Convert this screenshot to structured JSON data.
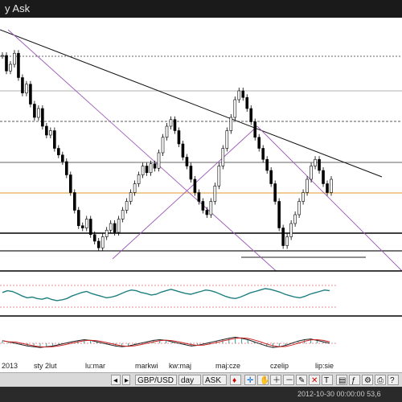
{
  "window": {
    "title_fragment": "y Ask"
  },
  "axis": {
    "date_labels": [
      "2013",
      "sty 2lut",
      "lu:mar",
      "markwi",
      "kw:maj",
      "maj:cze",
      "czelip",
      "lip:sie"
    ]
  },
  "toolbar": {
    "pair": "GBP/USD",
    "period": "day",
    "price_type": "ASK"
  },
  "status": {
    "datetime": "2012-10-30 00:00:00",
    "value": "53,6"
  },
  "colors": {
    "background": "#ffffff",
    "candle": "#000000",
    "trendline_purple": "#9b59b6",
    "horizontal_orange": "#e59a2c",
    "oscillator_line": "#1f7f7f",
    "oscillator_band": "#cc2222",
    "macd_signal": "#cc2222",
    "macd_line": "#222222",
    "macd_hist": "#3aa0a0"
  },
  "chart_data": {
    "type": "candlestick",
    "series": [
      {
        "name": "price",
        "values": [
          0.92,
          0.85,
          0.88,
          0.93,
          0.82,
          0.75,
          0.79,
          0.7,
          0.64,
          0.68,
          0.6,
          0.56,
          0.58,
          0.5,
          0.47,
          0.44,
          0.38,
          0.3,
          0.22,
          0.15,
          0.14,
          0.18,
          0.11,
          0.08,
          0.05,
          0.1,
          0.13,
          0.16,
          0.12,
          0.18,
          0.22,
          0.26,
          0.3,
          0.34,
          0.38,
          0.42,
          0.39,
          0.43,
          0.41,
          0.48,
          0.55,
          0.6,
          0.63,
          0.58,
          0.52,
          0.46,
          0.42,
          0.36,
          0.3,
          0.26,
          0.22,
          0.2,
          0.26,
          0.33,
          0.42,
          0.5,
          0.58,
          0.64,
          0.72,
          0.76,
          0.73,
          0.68,
          0.62,
          0.55,
          0.5,
          0.45,
          0.4,
          0.34,
          0.26,
          0.14,
          0.06,
          0.1,
          0.16,
          0.2,
          0.26,
          0.3,
          0.36,
          0.42,
          0.45,
          0.4,
          0.34,
          0.3,
          0.36
        ]
      },
      {
        "name": "oscillator",
        "values": [
          0.55,
          0.6,
          0.58,
          0.52,
          0.45,
          0.4,
          0.42,
          0.38,
          0.36,
          0.4,
          0.35,
          0.32,
          0.34,
          0.38,
          0.45,
          0.5,
          0.55,
          0.58,
          0.52,
          0.48,
          0.44,
          0.4,
          0.42,
          0.46,
          0.52,
          0.58,
          0.62,
          0.6,
          0.55,
          0.52,
          0.48,
          0.5,
          0.56,
          0.6,
          0.64,
          0.6,
          0.56,
          0.52,
          0.5,
          0.54,
          0.58,
          0.62,
          0.6,
          0.56,
          0.5,
          0.44,
          0.4,
          0.38,
          0.42,
          0.48,
          0.54,
          0.58,
          0.62,
          0.66,
          0.64,
          0.6,
          0.56,
          0.5,
          0.46,
          0.42,
          0.4,
          0.44,
          0.5,
          0.54,
          0.58,
          0.62,
          0.6
        ]
      },
      {
        "name": "macd",
        "values": [
          0.55,
          0.52,
          0.48,
          0.44,
          0.4,
          0.38,
          0.36,
          0.38,
          0.4,
          0.44,
          0.48,
          0.52,
          0.55,
          0.58,
          0.56,
          0.52,
          0.48,
          0.44,
          0.4,
          0.38,
          0.4,
          0.44,
          0.48,
          0.52,
          0.56,
          0.58,
          0.56,
          0.52,
          0.48,
          0.44,
          0.4,
          0.42,
          0.46,
          0.5,
          0.54,
          0.58,
          0.62,
          0.65,
          0.62,
          0.58,
          0.52,
          0.46,
          0.4,
          0.36,
          0.38,
          0.42,
          0.48,
          0.54,
          0.58,
          0.6,
          0.56,
          0.52,
          0.48
        ]
      }
    ]
  }
}
